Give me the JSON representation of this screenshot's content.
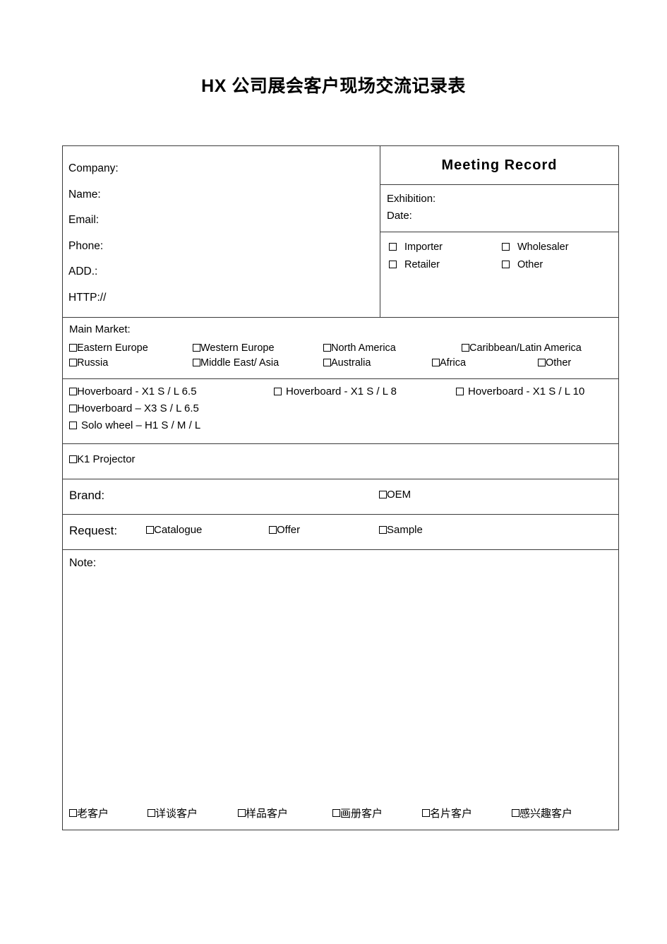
{
  "document": {
    "title": "HX 公司展会客户现场交流记录表"
  },
  "contact": {
    "fields": [
      "Company:",
      "Name:",
      "Email:",
      "Phone:",
      "ADD.:",
      "HTTP://"
    ]
  },
  "meeting": {
    "header": "Meeting  Record",
    "exhibition_label": "Exhibition:",
    "date_label": "Date:",
    "customer_types": [
      "Importer",
      "Wholesaler",
      "Retailer",
      "Other"
    ]
  },
  "main_market": {
    "title": "Main  Market:",
    "row1": [
      "Eastern  Europe",
      "Western  Europe",
      "North  America",
      "Caribbean/Latin  America"
    ],
    "row2": [
      "Russia",
      "Middle  East/  Asia",
      "Australia",
      "Africa",
      "Other"
    ]
  },
  "products": {
    "row1": [
      "Hoverboard  -  X1  S  /  L  6.5",
      "Hoverboard  -  X1  S  /  L  8",
      "Hoverboard  -  X1  S  /  L  10"
    ],
    "row2": "Hoverboard  –  X3 S / L 6.5",
    "row3": "Solo  wheel  –  H1   S  /  M  /  L",
    "projector": "K1  Projector"
  },
  "brand": {
    "label": "Brand:",
    "oem": "OEM"
  },
  "request": {
    "label": "Request:",
    "options": [
      "Catalogue",
      "Offer",
      "Sample"
    ]
  },
  "note": {
    "label": "Note:",
    "customer_tags": [
      "老客户",
      "详谈客户",
      "样品客户",
      "画册客户",
      "名片客户",
      "感兴趣客户"
    ]
  }
}
